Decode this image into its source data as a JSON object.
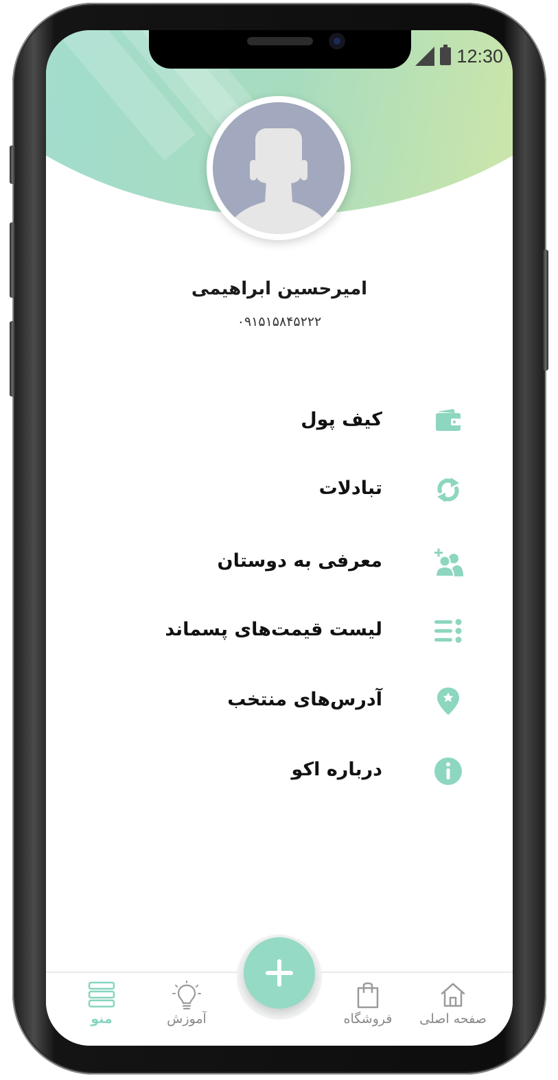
{
  "status_bar": {
    "time": "12:30"
  },
  "profile": {
    "name": "امیرحسین ابراهیمی",
    "phone": "۰۹۱۵۱۵۸۴۵۲۲۲"
  },
  "menu": [
    {
      "label": "کیف پول",
      "icon": "wallet-icon"
    },
    {
      "label": "تبادلات",
      "icon": "refresh-icon"
    },
    {
      "label": "معرفی به دوستان",
      "icon": "add-friends-icon"
    },
    {
      "label": "لیست قیمت‌های پسماند",
      "icon": "list-icon"
    },
    {
      "label": "آدرس‌های منتخب",
      "icon": "location-star-icon"
    },
    {
      "label": "درباره اکو",
      "icon": "info-icon"
    }
  ],
  "bottom_nav": {
    "home": "صفحه اصلی",
    "shop": "فروشگاه",
    "learning": "آموزش",
    "menu": "منو",
    "active": "menu"
  },
  "colors": {
    "accent": "#94dac5",
    "accent_icon": "#8dd6c0",
    "nav_active": "#86d5bf"
  }
}
